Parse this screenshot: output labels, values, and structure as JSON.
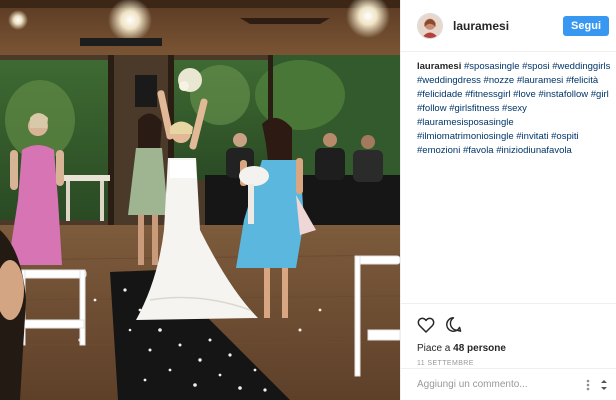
{
  "post": {
    "username": "lauramesi",
    "follow_label": "Segui",
    "caption": {
      "username": "lauramesi",
      "hashtags": [
        "#sposasingle",
        "#sposi",
        "#weddinggirls",
        "#weddingdress",
        "#nozze",
        "#lauramesi",
        "#felicità",
        "#felicidade",
        "#fitnessgirl",
        "#love",
        "#instafollow",
        "#girl",
        "#follow",
        "#girlsfitness",
        "#sexy",
        "#lauramesisposasingle",
        "#ilmiomatrimoniosingle",
        "#invitati",
        "#ospiti",
        "#emozioni",
        "#favola",
        "#iniziodiunafavola"
      ]
    },
    "likes_prefix": "Piace a ",
    "likes_count": "48 persone",
    "date": "11 SETTEMBRE",
    "comment_placeholder": "Aggiungi un commento...",
    "icons": {
      "like": "heart-icon",
      "comment": "comment-bubble-icon",
      "options": "more-options-icon",
      "scroll": "scroll-arrows-icon"
    },
    "colors": {
      "follow_button": "#3897f0",
      "hashtag": "#003569",
      "muted": "#999999",
      "border": "#efefef"
    }
  }
}
